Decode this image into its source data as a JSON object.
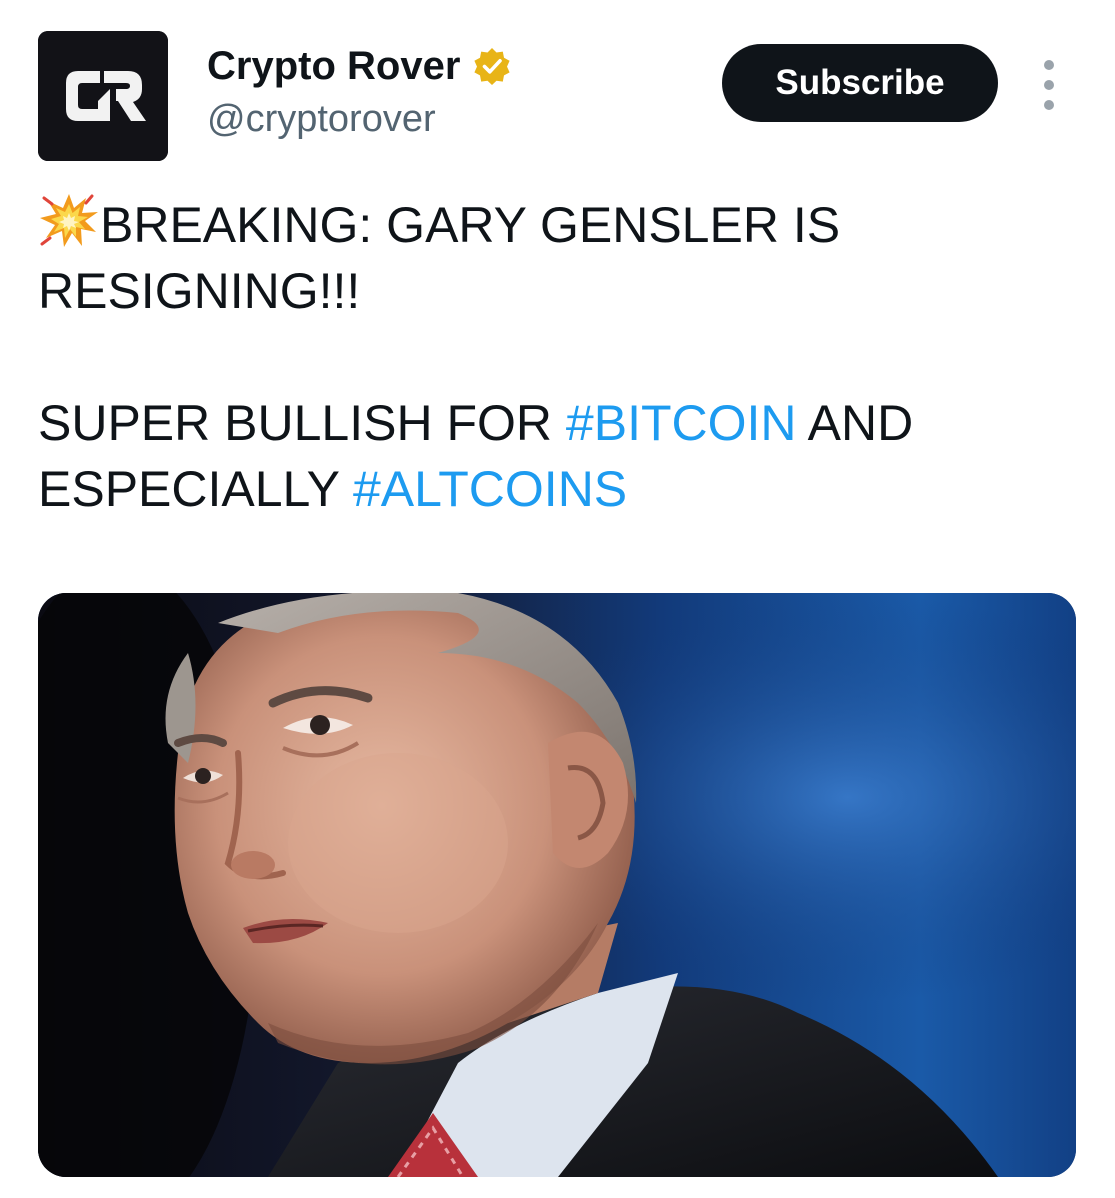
{
  "account": {
    "display_name": "Crypto Rover",
    "handle": "@cryptorover",
    "avatar_initials": "CR",
    "verified": true,
    "verified_color": "#e8b417"
  },
  "actions": {
    "subscribe_label": "Subscribe",
    "more_icon": "more-vertical-icon"
  },
  "tweet": {
    "line1_emoji": "💥",
    "line1_text": "BREAKING: GARY GENSLER IS RESIGNING!!!",
    "line2_prefix": "SUPER BULLISH FOR ",
    "hashtag1": "#BITCOIN",
    "line2_middle": " AND ESPECIALLY ",
    "hashtag2": "#ALTCOINS"
  },
  "colors": {
    "text": "#0f1419",
    "secondary_text": "#536471",
    "hashtag": "#1d9bf0",
    "button_bg": "#0f1419",
    "button_text": "#ffffff"
  },
  "media": {
    "type": "photo"
  }
}
